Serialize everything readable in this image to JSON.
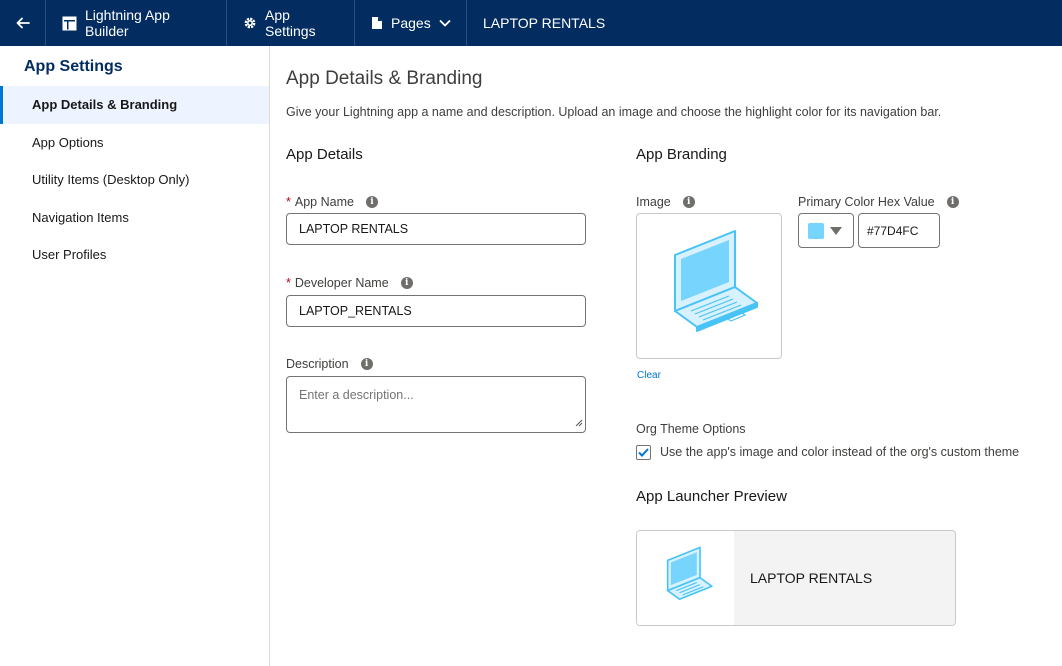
{
  "topbar": {
    "builder_label": "Lightning App Builder",
    "settings_label": "App Settings",
    "pages_label": "Pages",
    "app_title": "LAPTOP RENTALS"
  },
  "sidebar": {
    "title": "App Settings",
    "items": [
      {
        "label": "App Details & Branding",
        "active": true
      },
      {
        "label": "App Options"
      },
      {
        "label": "Utility Items (Desktop Only)"
      },
      {
        "label": "Navigation Items"
      },
      {
        "label": "User Profiles"
      }
    ]
  },
  "main": {
    "title": "App Details & Branding",
    "description": "Give your Lightning app a name and description. Upload an image and choose the highlight color for its navigation bar.",
    "details": {
      "section_title": "App Details",
      "app_name_label": "App Name",
      "app_name_value": "LAPTOP RENTALS",
      "dev_name_label": "Developer Name",
      "dev_name_value": "LAPTOP_RENTALS",
      "desc_label": "Description",
      "desc_placeholder": "Enter a description..."
    },
    "branding": {
      "section_title": "App Branding",
      "image_label": "Image",
      "clear_label": "Clear",
      "color_label": "Primary Color Hex Value",
      "color_value": "#77D4FC",
      "org_theme_label": "Org Theme Options",
      "org_theme_checkbox_label": "Use the app's image and color instead of the org's custom theme",
      "org_theme_checked": true
    },
    "preview": {
      "section_title": "App Launcher Preview",
      "app_name": "LAPTOP RENTALS"
    }
  },
  "colors": {
    "topbar_bg": "#032d60",
    "accent": "#0176d3",
    "brand_color": "#77D4FC",
    "required": "#ba0517"
  }
}
